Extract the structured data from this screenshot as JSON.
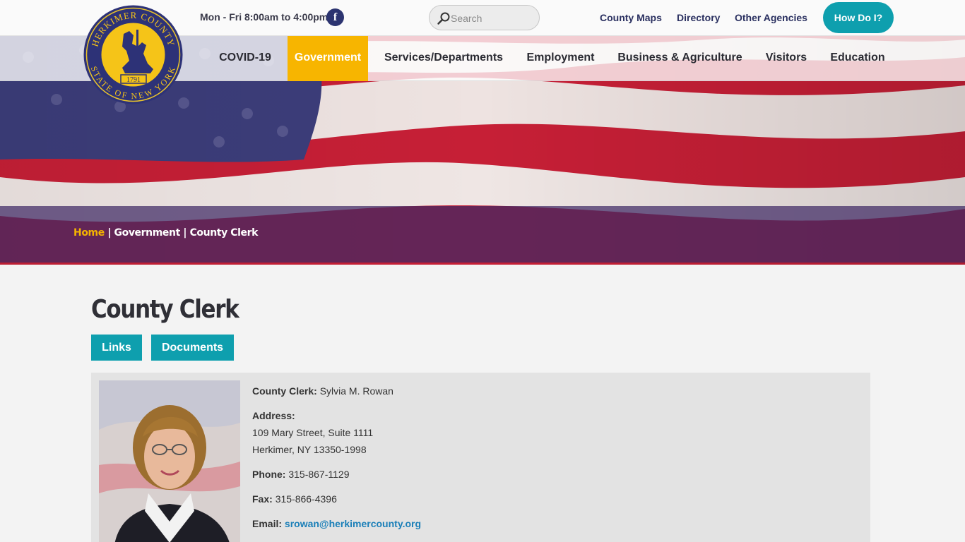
{
  "topbar": {
    "hours": "Mon - Fri 8:00am to 4:00pm",
    "facebook_icon": "f",
    "search_placeholder": "Search",
    "links": [
      "County Maps",
      "Directory",
      "Other Agencies"
    ],
    "how_do_i": "How Do I?"
  },
  "seal": {
    "top_text": "HERKIMER COUNTY",
    "bottom_text": "STATE OF NEW YORK",
    "year": "1791"
  },
  "nav": {
    "items": [
      "COVID-19",
      "Government",
      "Services/Departments",
      "Employment",
      "Business & Agriculture",
      "Visitors",
      "Education"
    ],
    "active": "Government"
  },
  "breadcrumb": {
    "home": "Home",
    "sep": "|",
    "level1": "Government",
    "level2": "County Clerk"
  },
  "page": {
    "title": "County Clerk",
    "buttons": [
      "Links",
      "Documents"
    ]
  },
  "contact": {
    "clerk_label": "County Clerk:",
    "clerk_name": "Sylvia M. Rowan",
    "address_label": "Address:",
    "address_line1": "109 Mary Street, Suite 1111",
    "address_line2": "Herkimer, NY 13350-1998",
    "phone_label": "Phone:",
    "phone": "315-867-1129",
    "fax_label": "Fax:",
    "fax": "315-866-4396",
    "email_label": "Email:",
    "email": "srowan@herkimercounty.org"
  },
  "colors": {
    "accent_teal": "#0e9fae",
    "active_nav": "#f7b500",
    "navy": "#2a3060"
  }
}
